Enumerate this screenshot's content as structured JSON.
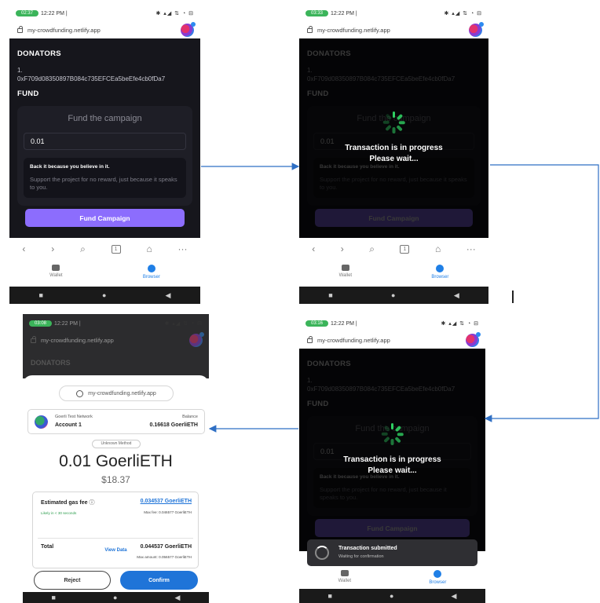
{
  "status": {
    "p1": {
      "call": "02:37",
      "time": "12:22 PM |",
      "icons": "✱ ▴◢ ⇅ ◔ ⊟"
    },
    "p2": {
      "call": "03:33",
      "time": "12:22 PM |",
      "icons": "✱ ▴◢ ⇅ ◔ ⊟"
    },
    "p3": {
      "call": "03:08",
      "time": "12:22 PM |",
      "icons": "✱ ▴◢ ⇅ ◔ ⊟"
    },
    "p4": {
      "call": "03:16",
      "time": "12:22 PM |",
      "icons": "✱ ▴◢ ⇅ ◔ ⊟"
    }
  },
  "url": "my-crowdfunding.netlify.app",
  "app": {
    "donators_title": "DONATORS",
    "donator_index": "1.",
    "donator_address": "0xF709d08350897B084c735EFCEa5beEfe4cb0fDa7",
    "fund_title": "FUND",
    "card_title": "Fund the campaign",
    "amount_value": "0.01",
    "info_title": "Back it because you believe in it.",
    "info_text": "Support the project for no reward, just because it speaks to you.",
    "fund_button": "Fund Campaign"
  },
  "loader": {
    "line1": "Transaction is in progress",
    "line2": "Please wait..."
  },
  "browser_nav": {
    "back": "‹",
    "forward": "›",
    "search": "⌕",
    "tabs": "1",
    "home": "⌂",
    "more": "···"
  },
  "bottom_nav": {
    "wallet": "Wallet",
    "browser": "Browser"
  },
  "sys_nav": {
    "square": "■",
    "circle": "●",
    "back": "◀"
  },
  "confirm": {
    "origin": "my-crowdfunding.netlify.app",
    "network": "Goerli Test Network",
    "account": "Account 1",
    "balance_label": "Balance",
    "balance": "0.16618 GoerliETH",
    "method": "Unknown Method",
    "amount": "0.01 GoerliETH",
    "usd": "$18.37",
    "gas_label": "Estimated gas fee",
    "gas_value": "0.034537 GoerliETH",
    "likely": "Likely in < 30 seconds",
    "max_fee": "Max fee: 0.046577 GoerliETH",
    "total_label": "Total",
    "total_value": "0.044537 GoerliETH",
    "max_amount": "Max amount: 0.056577 GoerliETH",
    "view_data": "View Data",
    "reject": "Reject",
    "confirm": "Confirm"
  },
  "toast": {
    "title": "Transaction submitted",
    "subtitle": "Waiting for confirmation"
  }
}
